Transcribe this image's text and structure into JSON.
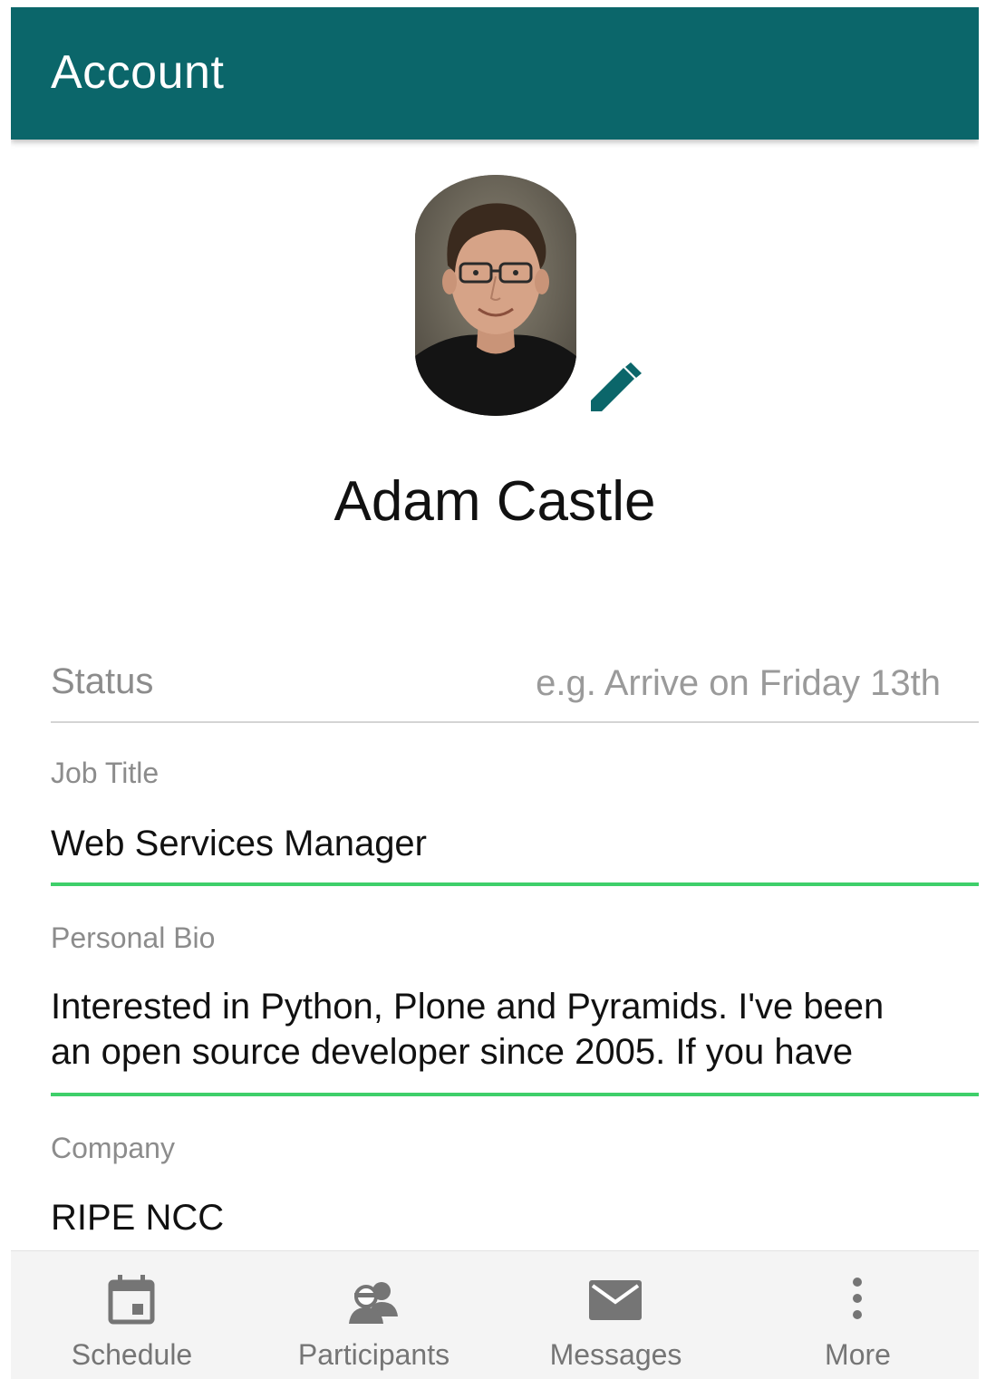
{
  "appbar": {
    "title": "Account"
  },
  "profile": {
    "name": "Adam Castle"
  },
  "status": {
    "label": "Status",
    "placeholder": "e.g. Arrive on Friday 13th",
    "value": ""
  },
  "job_title": {
    "label": "Job Title",
    "value": "Web Services Manager"
  },
  "bio": {
    "label": "Personal Bio",
    "line1": "Interested in Python, Plone and Pyramids. I've been",
    "line2": "an open source developer since 2005. If you have"
  },
  "company": {
    "label": "Company",
    "value": "RIPE NCC"
  },
  "bottom_nav": {
    "items": [
      {
        "label": "Schedule",
        "icon": "calendar-icon"
      },
      {
        "label": "Participants",
        "icon": "people-icon"
      },
      {
        "label": "Messages",
        "icon": "envelope-icon"
      },
      {
        "label": "More",
        "icon": "more-vertical-icon"
      }
    ]
  },
  "colors": {
    "appbar": "#0b666a",
    "accent": "#0b666a",
    "focus_underline": "#3ecf6a",
    "nav_icon": "#757575"
  }
}
